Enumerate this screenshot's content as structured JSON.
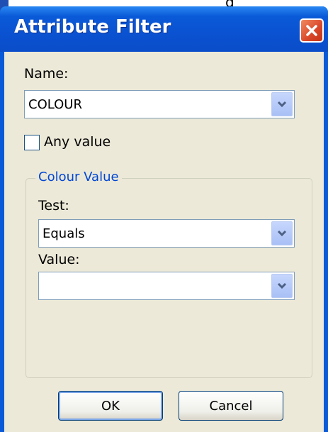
{
  "background_fragment": {
    "text": "g"
  },
  "dialog": {
    "title": "Attribute Filter",
    "name_label": "Name:",
    "name_value": "COLOUR",
    "any_value_label": "Any value",
    "any_value_checked": false,
    "group_title": "Colour Value",
    "test_label": "Test:",
    "test_value": "Equals",
    "value_label": "Value:",
    "value_value": "",
    "ok_label": "OK",
    "cancel_label": "Cancel"
  },
  "icons": {
    "close": "close-icon",
    "dropdown": "chevron-down-icon"
  },
  "colors": {
    "titlebar": "#0a5ad8",
    "client_bg": "#ece9d8",
    "group_title": "#0046d5",
    "close_button": "#d9472a"
  }
}
